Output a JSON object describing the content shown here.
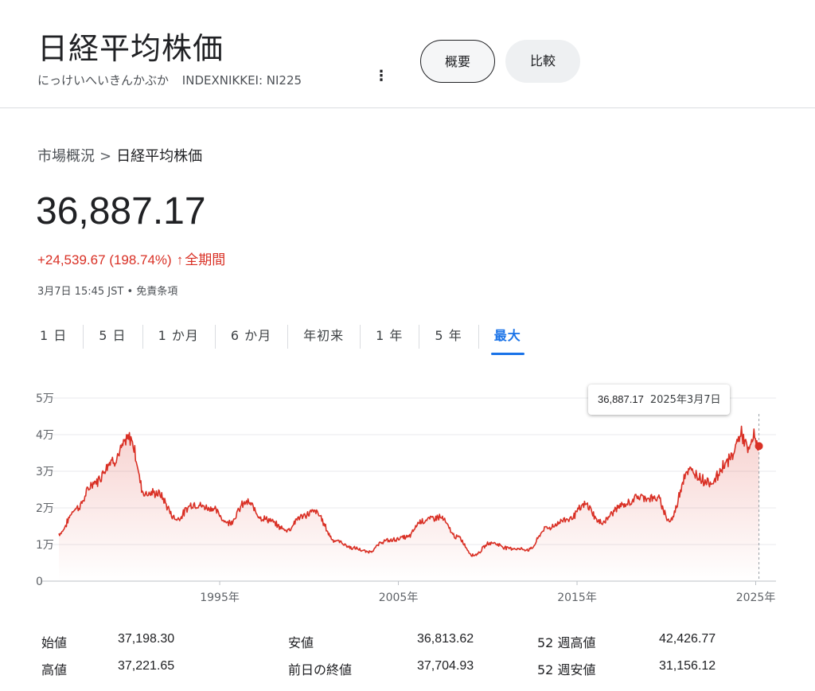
{
  "header": {
    "title": "日経平均株価",
    "reading": "にっけいへいきんかぶか",
    "ticker": "INDEXNIKKEI: NI225",
    "more_label": "⋮",
    "tab_overview": "概要",
    "tab_compare": "比較"
  },
  "breadcrumb": {
    "parent": "市場概況",
    "separator": ">",
    "current": "日経平均株価"
  },
  "quote": {
    "price": "36,887.17",
    "change": "+24,539.67 (198.74%)",
    "arrow": "↑",
    "period": "全期間",
    "timestamp": "3月7日 15:45 JST",
    "dot": " • ",
    "disclaimer": "免責条項"
  },
  "ranges": [
    "1 日",
    "5 日",
    "1 か月",
    "6 か月",
    "年初来",
    "1 年",
    "5 年",
    "最大"
  ],
  "active_range": "最大",
  "tooltip": {
    "value": "36,887.17",
    "date": "2025年3月7日"
  },
  "colors": {
    "line": "#d93025",
    "accent": "#1a73e8"
  },
  "chart_data": {
    "type": "area",
    "x": [
      1986.0,
      1987.0,
      1988.0,
      1989.0,
      1989.99,
      1990.8,
      1991.5,
      1992.6,
      1993.5,
      1994.5,
      1995.5,
      1996.5,
      1997.5,
      1998.8,
      1999.5,
      2000.3,
      2001.5,
      2002.5,
      2003.3,
      2004.3,
      2005.5,
      2006.3,
      2007.3,
      2008.3,
      2009.2,
      2010.2,
      2011.2,
      2012.3,
      2013.3,
      2014.5,
      2015.5,
      2016.3,
      2017.5,
      2018.5,
      2019.5,
      2020.2,
      2021.2,
      2022.5,
      2023.5,
      2024.2,
      2024.6,
      2024.9,
      2025.18
    ],
    "y": [
      13000,
      20000,
      27000,
      33000,
      38900,
      24000,
      24000,
      17000,
      21000,
      20000,
      16000,
      21500,
      17000,
      14000,
      17500,
      19000,
      11000,
      9000,
      8000,
      11000,
      12000,
      16500,
      17500,
      12000,
      7100,
      10500,
      9000,
      8600,
      14500,
      17000,
      20800,
      16000,
      20500,
      23000,
      22500,
      16500,
      30000,
      27000,
      33000,
      40000,
      35500,
      39500,
      36887
    ],
    "xticks": [
      "1995年",
      "2005年",
      "2015年",
      "2025年"
    ],
    "xtick_values": [
      1995,
      2005,
      2015,
      2025
    ],
    "yticks": [
      "0",
      "1万",
      "2万",
      "3万",
      "4万",
      "5万"
    ],
    "ytick_values": [
      0,
      10000,
      20000,
      30000,
      40000,
      50000
    ],
    "xlim": [
      1986.0,
      2025.2
    ],
    "ylim": [
      0,
      50000
    ],
    "grid": true,
    "last_value": 36887.17
  },
  "stats": [
    {
      "label": "始値",
      "value": "37,198.30"
    },
    {
      "label": "安値",
      "value": "36,813.62"
    },
    {
      "label": "52 週高値",
      "value": "42,426.77"
    },
    {
      "label": "高値",
      "value": "37,221.65"
    },
    {
      "label": "前日の終値",
      "value": "37,704.93"
    },
    {
      "label": "52 週安値",
      "value": "31,156.12"
    }
  ]
}
